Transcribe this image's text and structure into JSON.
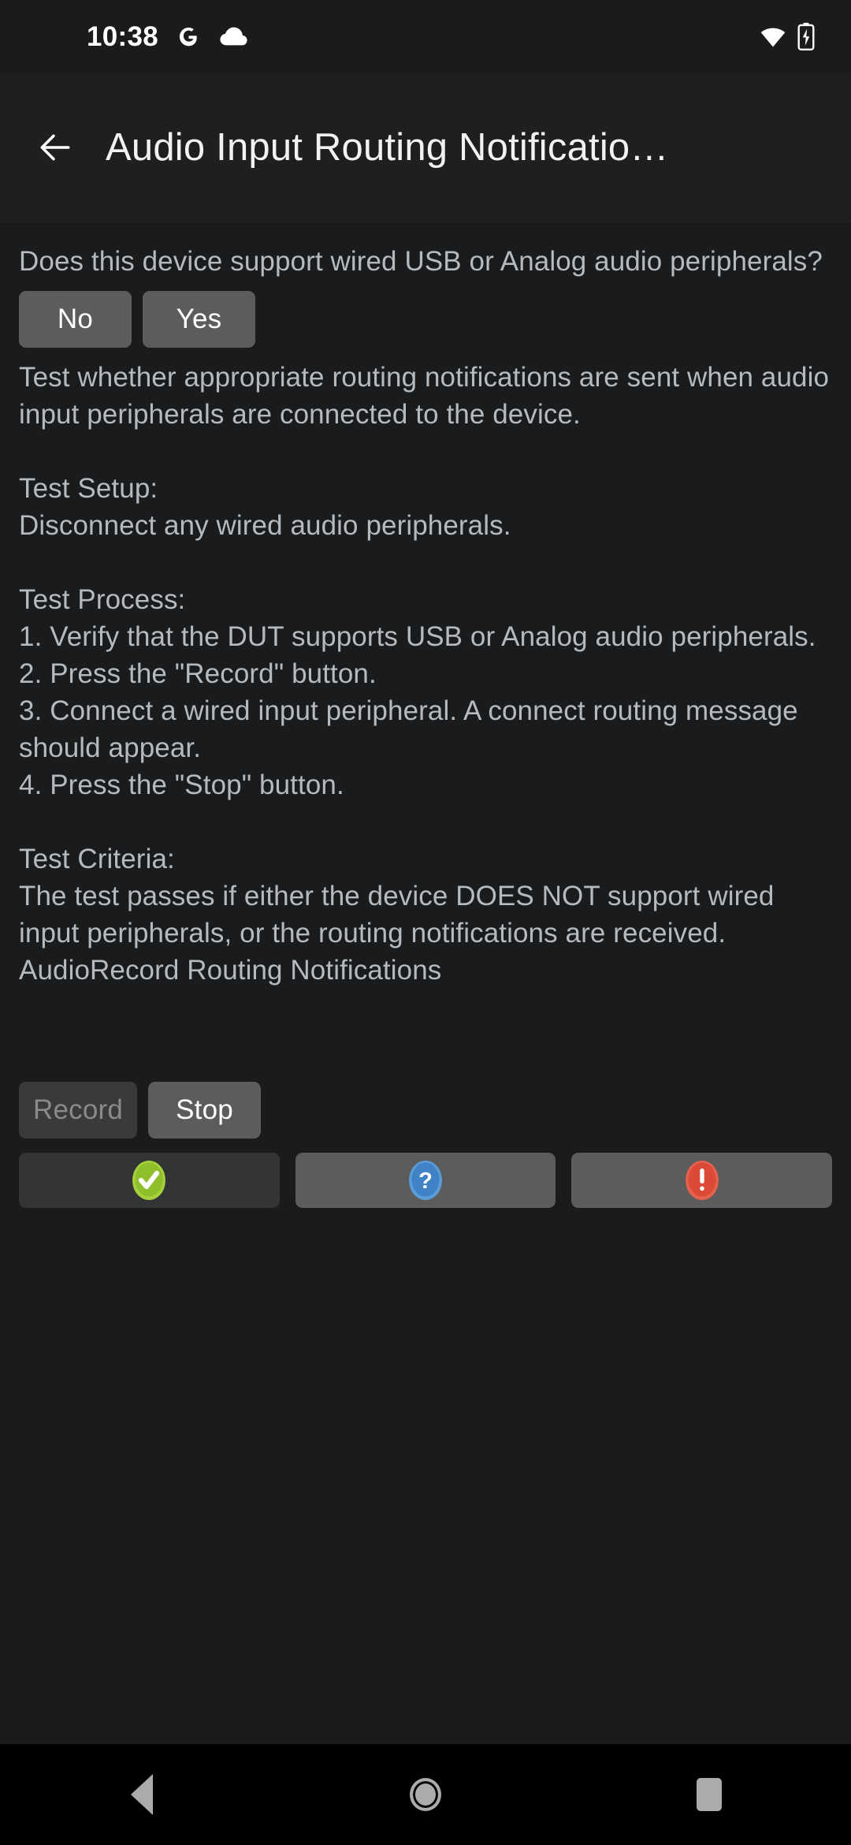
{
  "status_bar": {
    "time": "10:38",
    "icons": [
      "google-g-icon",
      "cloud-icon"
    ],
    "right_icons": [
      "wifi-icon",
      "battery-charging-icon"
    ]
  },
  "app_bar": {
    "back_icon": "back-arrow-icon",
    "title": "Audio Input Routing Notificatio…"
  },
  "main": {
    "question": "Does this device support wired USB or Analog audio peripherals?",
    "answer_buttons": [
      {
        "label": "No",
        "state": "enabled"
      },
      {
        "label": "Yes",
        "state": "enabled"
      }
    ],
    "description": "Test whether appropriate routing notifications are sent when audio input peripherals are connected to the device.\n\nTest Setup:\nDisconnect any wired audio peripherals.\n\nTest Process:\n1. Verify that the DUT supports USB or Analog audio peripherals.\n2. Press the \"Record\" button.\n3. Connect a wired input peripheral. A connect routing message should appear.\n4. Press the \"Stop\" button.\n\nTest Criteria:\nThe test passes if either the device DOES NOT support wired input peripherals, or the routing notifications are received.\nAudioRecord Routing Notifications",
    "media_buttons": [
      {
        "label": "Record",
        "state": "disabled"
      },
      {
        "label": "Stop",
        "state": "enabled"
      }
    ],
    "verdict_buttons": [
      {
        "icon": "pass-check-icon",
        "state": "disabled",
        "color": "#9ACD32"
      },
      {
        "icon": "info-question-icon",
        "state": "enabled",
        "color": "#4A90D9"
      },
      {
        "icon": "fail-exclamation-icon",
        "state": "enabled",
        "color": "#E0503F"
      }
    ]
  },
  "nav_bar": {
    "back_label": "back-triangle-icon",
    "home_label": "home-circle-icon",
    "recents_label": "recents-square-icon"
  },
  "colors": {
    "background": "#191B1C",
    "app_bar": "#1D1F20",
    "button_enabled": "#5C5C5C",
    "button_disabled": "#3A3A3A",
    "body_text": "#B6BABD",
    "nav_bar": "#000000"
  }
}
